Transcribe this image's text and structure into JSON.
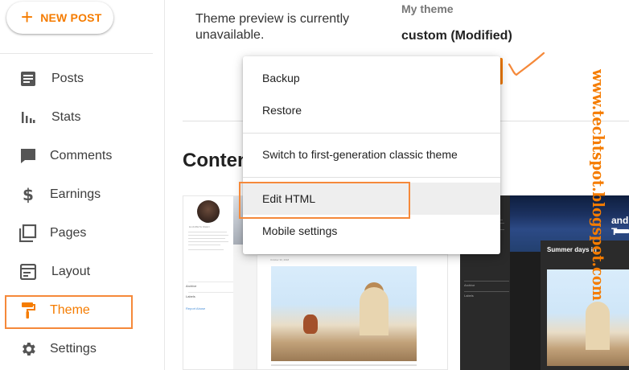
{
  "sidebar": {
    "new_post_icon": "plus-icon",
    "new_post_label": "NEW POST",
    "items": [
      {
        "label": "Posts",
        "icon": "posts-icon"
      },
      {
        "label": "Stats",
        "icon": "stats-icon"
      },
      {
        "label": "Comments",
        "icon": "comments-icon"
      },
      {
        "label": "Earnings",
        "icon": "dollar-icon"
      },
      {
        "label": "Pages",
        "icon": "pages-icon"
      },
      {
        "label": "Layout",
        "icon": "layout-icon"
      },
      {
        "label": "Theme",
        "icon": "paint-roller-icon",
        "active": true
      },
      {
        "label": "Settings",
        "icon": "gear-icon"
      }
    ]
  },
  "main": {
    "preview_message": "Theme preview is currently unavailable.",
    "my_theme_label": "My theme",
    "theme_name": "custom (Modified)",
    "content_heading": "Conten"
  },
  "menu": {
    "items": [
      "Backup",
      "Restore",
      "Switch to first-generation classic theme",
      "Edit HTML",
      "Mobile settings"
    ],
    "highlighted": "Edit HTML"
  },
  "thumbnails": {
    "light": {
      "author": "ELIZABETH REEN",
      "archive": "Archive",
      "labels": "Labels",
      "report": "Report Abuse",
      "date": "October 30, 2018"
    },
    "dark": {
      "title": "and T",
      "card_title": "Summer days in",
      "archive": "Archive",
      "labels": "Labels"
    }
  },
  "watermark": "www.techtspot.blogspot.com",
  "colors": {
    "accent": "#f57c00",
    "annotation_outline": "#f5893a",
    "watermark": "#f57c00"
  }
}
